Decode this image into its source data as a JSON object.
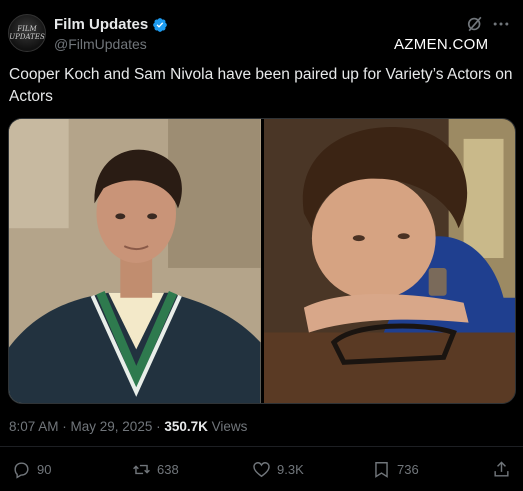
{
  "post": {
    "author": {
      "display_name": "Film Updates",
      "handle": "@FilmUpdates",
      "avatar_text_line1": "FILM",
      "avatar_text_line2": "UPDATES"
    },
    "watermark": "AZMEN.COM",
    "text": "Cooper Koch and Sam Nivola have been paired up for Variety’s Actors on Actors",
    "timestamp": "8:07 AM · May 29, 2025 · ",
    "views_count": "350.7K",
    "views_label": " Views",
    "metrics": {
      "replies": "90",
      "reposts": "638",
      "likes": "9.3K",
      "bookmarks": "736"
    }
  },
  "colors": {
    "background": "#000000",
    "text_primary": "#e7e9ea",
    "text_secondary": "#71767b",
    "verified_blue": "#1d9bf0"
  },
  "icons": [
    "verified-badge-icon",
    "grok-icon",
    "more-icon",
    "reply-icon",
    "repost-icon",
    "like-icon",
    "bookmark-icon",
    "share-icon"
  ]
}
